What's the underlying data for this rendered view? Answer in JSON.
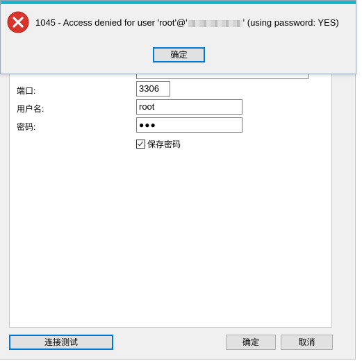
{
  "error_dialog": {
    "message_prefix": "1045 - Access denied for user 'root'@'",
    "message_suffix": "' (using password: YES)",
    "ok_label": "确定"
  },
  "connection_form": {
    "host_value": "",
    "port_label": "端口:",
    "port_value": "3306",
    "username_label": "用户名:",
    "username_value": "root",
    "password_label": "密码:",
    "password_value": "●●●",
    "save_password_label": "保存密码",
    "save_password_checked": true
  },
  "footer": {
    "test_connection_label": "连接测试",
    "ok_label": "确定",
    "cancel_label": "取消"
  },
  "colors": {
    "accent": "#19b7c7",
    "error_icon": "#d9342b",
    "default_button_border": "#0078d7"
  }
}
